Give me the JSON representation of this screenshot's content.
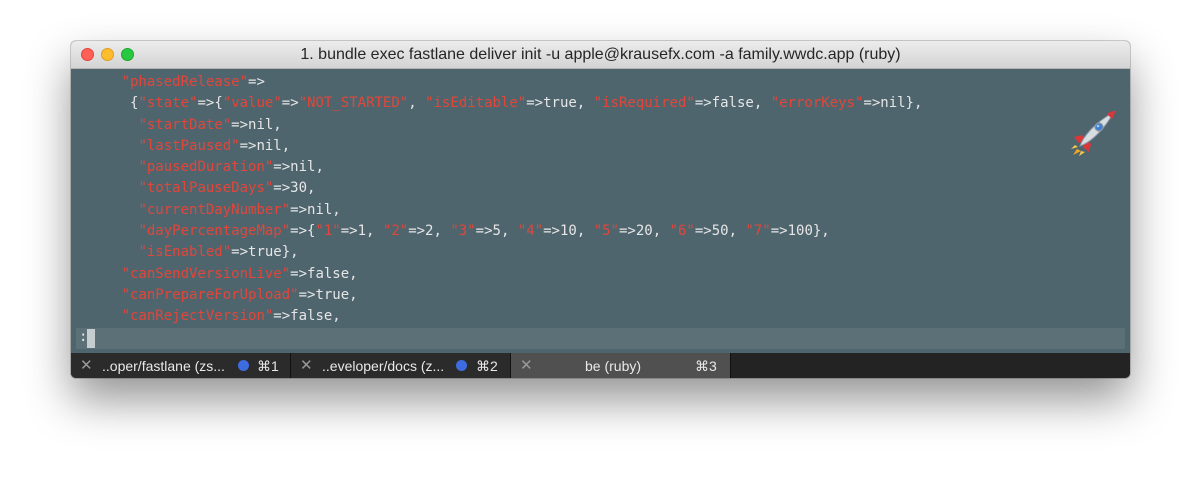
{
  "window": {
    "title": "1. bundle exec fastlane deliver init -u apple@krausefx.com -a family.wwdc.app (ruby)"
  },
  "terminal": {
    "lines": [
      [
        {
          "p": "  "
        },
        {
          "k": "\"phasedRelease\""
        },
        {
          "t": "=>"
        }
      ],
      [
        {
          "p": "   "
        },
        {
          "t": "{"
        },
        {
          "k": "\"state\""
        },
        {
          "t": "=>{"
        },
        {
          "k": "\"value\""
        },
        {
          "t": "=>"
        },
        {
          "k": "\"NOT_STARTED\""
        },
        {
          "t": ", "
        },
        {
          "k": "\"isEditable\""
        },
        {
          "t": "=>true, "
        },
        {
          "k": "\"isRequired\""
        },
        {
          "t": "=>false, "
        },
        {
          "k": "\"errorKeys\""
        },
        {
          "t": "=>nil},"
        }
      ],
      [
        {
          "p": "    "
        },
        {
          "k": "\"startDate\""
        },
        {
          "t": "=>nil,"
        }
      ],
      [
        {
          "p": "    "
        },
        {
          "k": "\"lastPaused\""
        },
        {
          "t": "=>nil,"
        }
      ],
      [
        {
          "p": "    "
        },
        {
          "k": "\"pausedDuration\""
        },
        {
          "t": "=>nil,"
        }
      ],
      [
        {
          "p": "    "
        },
        {
          "k": "\"totalPauseDays\""
        },
        {
          "t": "=>30,"
        }
      ],
      [
        {
          "p": "    "
        },
        {
          "k": "\"currentDayNumber\""
        },
        {
          "t": "=>nil,"
        }
      ],
      [
        {
          "p": "    "
        },
        {
          "k": "\"dayPercentageMap\""
        },
        {
          "t": "=>{"
        },
        {
          "k": "\"1\""
        },
        {
          "t": "=>1, "
        },
        {
          "k": "\"2\""
        },
        {
          "t": "=>2, "
        },
        {
          "k": "\"3\""
        },
        {
          "t": "=>5, "
        },
        {
          "k": "\"4\""
        },
        {
          "t": "=>10, "
        },
        {
          "k": "\"5\""
        },
        {
          "t": "=>20, "
        },
        {
          "k": "\"6\""
        },
        {
          "t": "=>50, "
        },
        {
          "k": "\"7\""
        },
        {
          "t": "=>100},"
        }
      ],
      [
        {
          "p": "    "
        },
        {
          "k": "\"isEnabled\""
        },
        {
          "t": "=>true},"
        }
      ],
      [
        {
          "p": "  "
        },
        {
          "k": "\"canSendVersionLive\""
        },
        {
          "t": "=>false,"
        }
      ],
      [
        {
          "p": "  "
        },
        {
          "k": "\"canPrepareForUpload\""
        },
        {
          "t": "=>true,"
        }
      ],
      [
        {
          "p": "  "
        },
        {
          "k": "\"canRejectVersion\""
        },
        {
          "t": "=>false,"
        }
      ]
    ],
    "prompt": ":",
    "badge_icon": "rocket-icon"
  },
  "tabs": [
    {
      "close": "✕",
      "label": "..oper/fastlane (zs...",
      "shortcut": "⌘1",
      "has_dot": true,
      "active": false
    },
    {
      "close": "✕",
      "label": "..eveloper/docs (z...",
      "shortcut": "⌘2",
      "has_dot": true,
      "active": false
    },
    {
      "close": "✕",
      "label": "be (ruby)",
      "shortcut": "⌘3",
      "has_dot": false,
      "active": true
    }
  ],
  "colors": {
    "terminal_bg": "#4f656e",
    "string_red": "#e1463a",
    "text": "#e6e6e6",
    "activity_dot": "#3d6be0"
  }
}
